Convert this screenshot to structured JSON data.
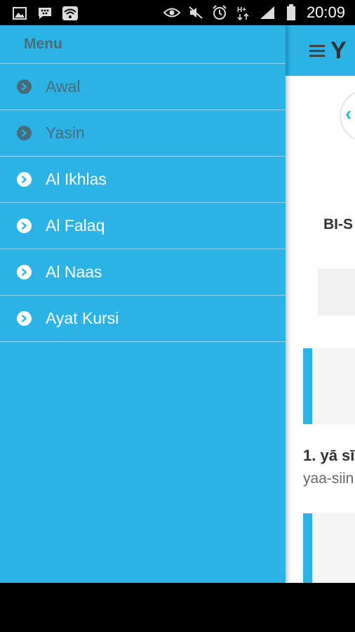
{
  "status_bar": {
    "time": "20:09",
    "left_icons": [
      "image-icon",
      "bbm-icon",
      "wifi-icon"
    ],
    "right_icons": [
      "eye-icon",
      "mute-icon",
      "alarm-icon",
      "hplus-data-icon",
      "signal-icon",
      "battery-icon"
    ]
  },
  "drawer": {
    "title": "Menu",
    "items": [
      {
        "label": "Awal",
        "state": "disabled"
      },
      {
        "label": "Yasin",
        "state": "disabled"
      },
      {
        "label": "Al Ikhlas",
        "state": "active"
      },
      {
        "label": "Al Falaq",
        "state": "active"
      },
      {
        "label": "Al Naas",
        "state": "active"
      },
      {
        "label": "Ayat Kursi",
        "state": "active"
      }
    ]
  },
  "main": {
    "title": "Y",
    "bismillah": "BI-S",
    "verse_number": "1. yā sī",
    "verse_transliteration": "yaa-siin"
  },
  "colors": {
    "accent": "#2bb3e6",
    "drawer_text_disabled": "#4a6c7a",
    "drawer_text_active": "#ffffff"
  }
}
